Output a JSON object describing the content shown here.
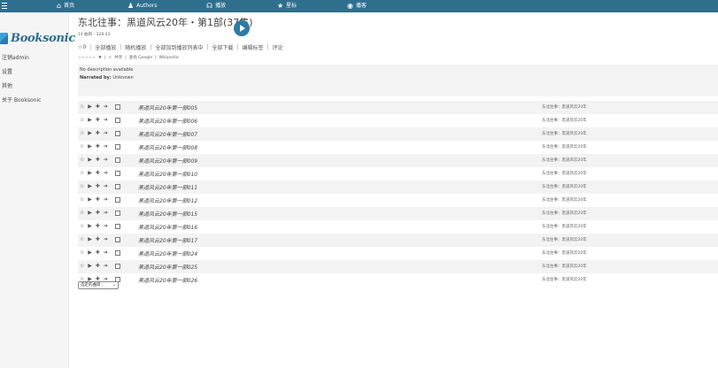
{
  "nav": {
    "items": [
      {
        "name": "home",
        "icon": "home-icon",
        "glyph": "⌂",
        "label": "首页"
      },
      {
        "name": "authors",
        "icon": "user-icon",
        "glyph": "♟",
        "label": "Authors"
      },
      {
        "name": "playback",
        "icon": "headphones-icon",
        "glyph": "☊",
        "label": "播放"
      },
      {
        "name": "starred",
        "icon": "star-icon",
        "glyph": "★",
        "label": "星标"
      },
      {
        "name": "podcast",
        "icon": "rss-icon",
        "glyph": "◉",
        "label": "播客"
      }
    ]
  },
  "sidebar": {
    "logo_text": "Booksonic",
    "links": [
      "注销admin",
      "设置",
      "其他",
      "关于 Booksonic"
    ]
  },
  "album": {
    "title": "东北往事：黑道风云20年・第1部(37集)",
    "meta": "14 曲目 - 328:43",
    "actions": [
      "0",
      "全部播放",
      "随机播放",
      "全部加到播放列表中",
      "全部下载",
      "编辑标签",
      "评论"
    ],
    "rating_row": {
      "stars": "☆☆☆☆☆",
      "clear": "✖",
      "share": "共享",
      "google": "查找 Google",
      "wiki": "Wikipedia"
    },
    "description": "No description available",
    "narrated_label": "Narrated by:",
    "narrated_value": "Unknown"
  },
  "track_icons": "☆ ▶ ✚ ➔",
  "tracks": [
    {
      "title": "黑道风云20年第一部005",
      "artist": "东北往事：黑道风云20年"
    },
    {
      "title": "黑道风云20年第一部006",
      "artist": "东北往事：黑道风云20年"
    },
    {
      "title": "黑道风云20年第一部007",
      "artist": "东北往事：黑道风云20年"
    },
    {
      "title": "黑道风云20年第一部008",
      "artist": "东北往事：黑道风云20年"
    },
    {
      "title": "黑道风云20年第一部009",
      "artist": "东北往事：黑道风云20年"
    },
    {
      "title": "黑道风云20年第一部010",
      "artist": "东北往事：黑道风云20年"
    },
    {
      "title": "黑道风云20年第一部011",
      "artist": "东北往事：黑道风云20年"
    },
    {
      "title": "黑道风云20年第一部012",
      "artist": "东北往事：黑道风云20年"
    },
    {
      "title": "黑道风云20年第一部015",
      "artist": "东北往事：黑道风云20年"
    },
    {
      "title": "黑道风云20年第一部016",
      "artist": "东北往事：黑道风云20年"
    },
    {
      "title": "黑道风云20年第一部017",
      "artist": "东北往事：黑道风云20年"
    },
    {
      "title": "黑道风云20年第一部024",
      "artist": "东北往事：黑道风云20年"
    },
    {
      "title": "黑道风云20年第一部025",
      "artist": "东北往事：黑道风云20年"
    },
    {
      "title": "黑道风云20年第一部026",
      "artist": "东北往事：黑道风云20年"
    }
  ],
  "selection": {
    "label": "选定的曲目..."
  },
  "colors": {
    "topbar": "#2e6f8e",
    "accent": "#2e7ba3",
    "logo": "#2e6f8e"
  }
}
